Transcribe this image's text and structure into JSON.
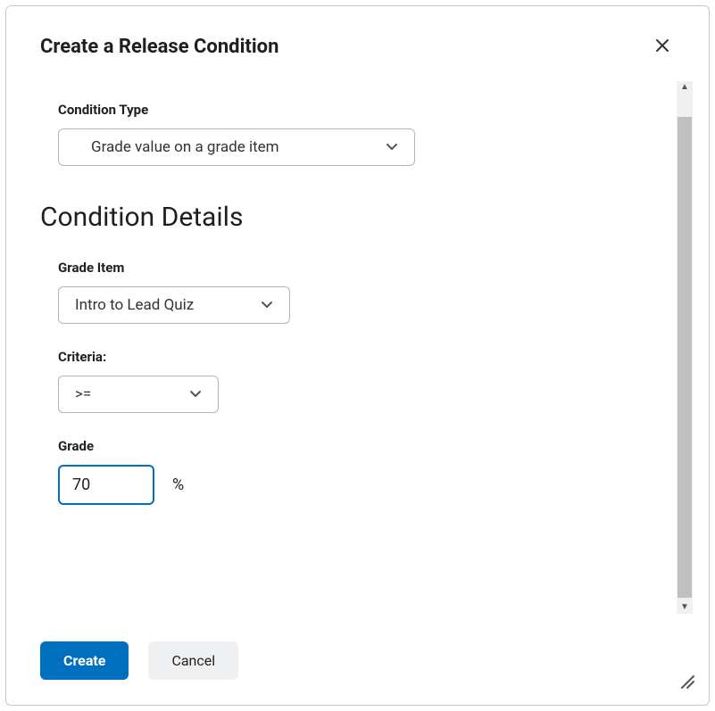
{
  "modal": {
    "title": "Create a Release Condition"
  },
  "form": {
    "condition_type_label": "Condition Type",
    "condition_type_value": "Grade value on a grade item",
    "section_heading": "Condition Details",
    "grade_item_label": "Grade Item",
    "grade_item_value": "Intro to Lead Quiz",
    "criteria_label": "Criteria:",
    "criteria_value": ">=",
    "grade_label": "Grade",
    "grade_value": "70",
    "percent_symbol": "%"
  },
  "footer": {
    "create_label": "Create",
    "cancel_label": "Cancel"
  }
}
